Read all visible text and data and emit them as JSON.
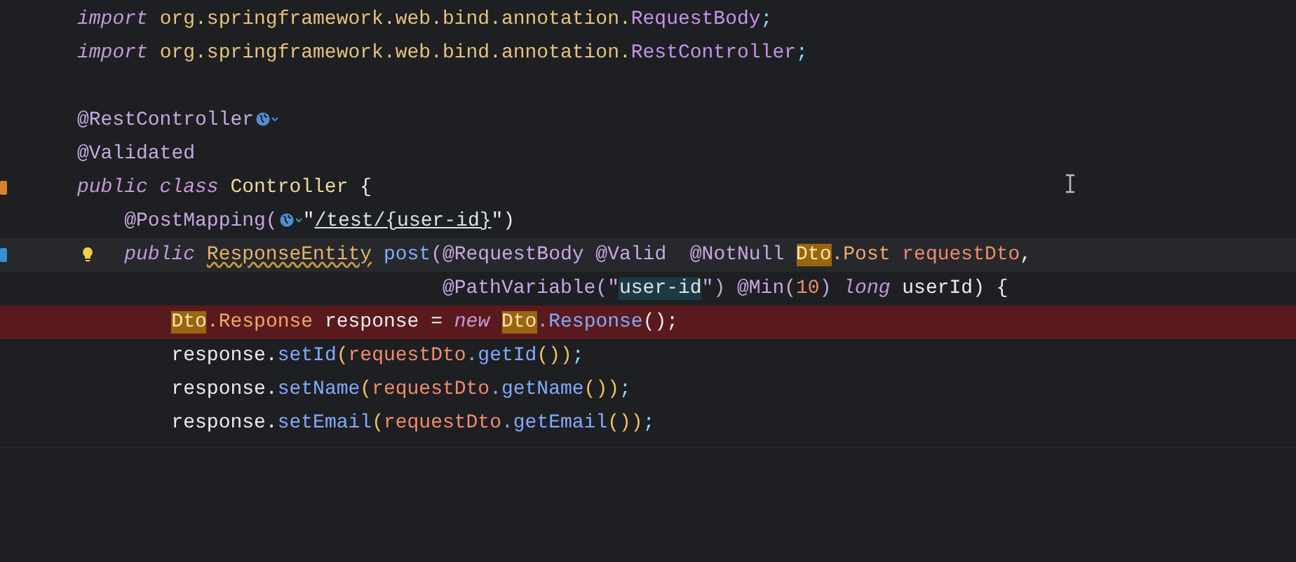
{
  "editor": {
    "lines": [
      {
        "tokens": [
          {
            "text": "import ",
            "kind": "keyword"
          },
          {
            "text": "org.springframework.web.bind.annotation.",
            "kind": "package"
          },
          {
            "text": "RequestBody",
            "kind": "class"
          },
          {
            "text": ";",
            "kind": "punct"
          }
        ]
      },
      {
        "tokens": [
          {
            "text": "import ",
            "kind": "keyword"
          },
          {
            "text": "org.springframework.web.bind.annotation.",
            "kind": "package"
          },
          {
            "text": "RestController",
            "kind": "class"
          },
          {
            "text": ";",
            "kind": "punct"
          }
        ]
      },
      {
        "kind": "blank"
      },
      {
        "tokens": [
          {
            "text": "@RestController",
            "kind": "annotation"
          },
          {
            "kind": "globe"
          }
        ]
      },
      {
        "tokens": [
          {
            "text": "@Validated",
            "kind": "annotation"
          }
        ]
      },
      {
        "color": "#d9822b",
        "tokens": [
          {
            "text": "public class ",
            "kind": "keyword"
          },
          {
            "text": "Controller",
            "kind": "classname"
          },
          {
            "text": " {",
            "kind": "plain"
          }
        ]
      },
      {
        "tokens": [
          {
            "text": "    @PostMapping(",
            "kind": "annotation"
          },
          {
            "kind": "globe"
          },
          {
            "text": "\"",
            "kind": "plain"
          },
          {
            "text": "/test/{user-id}",
            "kind": "link"
          },
          {
            "text": "\")",
            "kind": "plain"
          }
        ]
      },
      {
        "current": true,
        "bulb": true,
        "color": "#3b8ed0",
        "tokens": [
          {
            "text": "    public ",
            "kind": "keyword"
          },
          {
            "text": "ResponseEntity",
            "kind": "warning"
          },
          {
            "text": " post",
            "kind": "method"
          },
          {
            "text": "(@RequestBody @Valid  @NotNull ",
            "kind": "annotation"
          },
          {
            "text": "Dto",
            "kind": "match"
          },
          {
            "text": ".Post",
            "kind": "type"
          },
          {
            "text": " requestDto",
            "kind": "param"
          },
          {
            "text": ",",
            "kind": "plain"
          }
        ]
      },
      {
        "tokens": [
          {
            "text": "                               @PathVariable(\"",
            "kind": "annotation"
          },
          {
            "text": "user-id",
            "kind": "highlight"
          },
          {
            "text": "\") @Min(",
            "kind": "annotation"
          },
          {
            "text": "10",
            "kind": "number"
          },
          {
            "text": ") ",
            "kind": "annotation"
          },
          {
            "text": "long",
            "kind": "keyword"
          },
          {
            "text": " userId) {",
            "kind": "plain"
          }
        ]
      },
      {
        "error": true,
        "tokens": [
          {
            "text": "        Dto",
            "kind": "match"
          },
          {
            "text": ".Response",
            "kind": "type"
          },
          {
            "text": " response = ",
            "kind": "plain"
          },
          {
            "text": "new ",
            "kind": "keyword"
          },
          {
            "text": "Dto",
            "kind": "match"
          },
          {
            "text": ".Response",
            "kind": "method"
          },
          {
            "text": "();",
            "kind": "plain"
          }
        ]
      },
      {
        "tokens": [
          {
            "text": "        response.",
            "kind": "plain"
          },
          {
            "text": "setId",
            "kind": "method"
          },
          {
            "text": "(",
            "kind": "paren"
          },
          {
            "text": "requestDto",
            "kind": "param"
          },
          {
            "text": ".getId",
            "kind": "method"
          },
          {
            "text": "())",
            "kind": "paren"
          },
          {
            "text": ";",
            "kind": "punct"
          }
        ]
      },
      {
        "tokens": [
          {
            "text": "        response.",
            "kind": "plain"
          },
          {
            "text": "setName",
            "kind": "method"
          },
          {
            "text": "(",
            "kind": "paren"
          },
          {
            "text": "requestDto",
            "kind": "param"
          },
          {
            "text": ".getName",
            "kind": "method"
          },
          {
            "text": "())",
            "kind": "paren"
          },
          {
            "text": ";",
            "kind": "punct"
          }
        ]
      },
      {
        "tokens": [
          {
            "text": "        response.",
            "kind": "plain"
          },
          {
            "text": "setEmail",
            "kind": "method"
          },
          {
            "text": "(",
            "kind": "paren"
          },
          {
            "text": "requestDto",
            "kind": "param"
          },
          {
            "text": ".getEmail",
            "kind": "method"
          },
          {
            "text": "())",
            "kind": "paren"
          },
          {
            "text": ";",
            "kind": "punct"
          }
        ]
      }
    ]
  }
}
